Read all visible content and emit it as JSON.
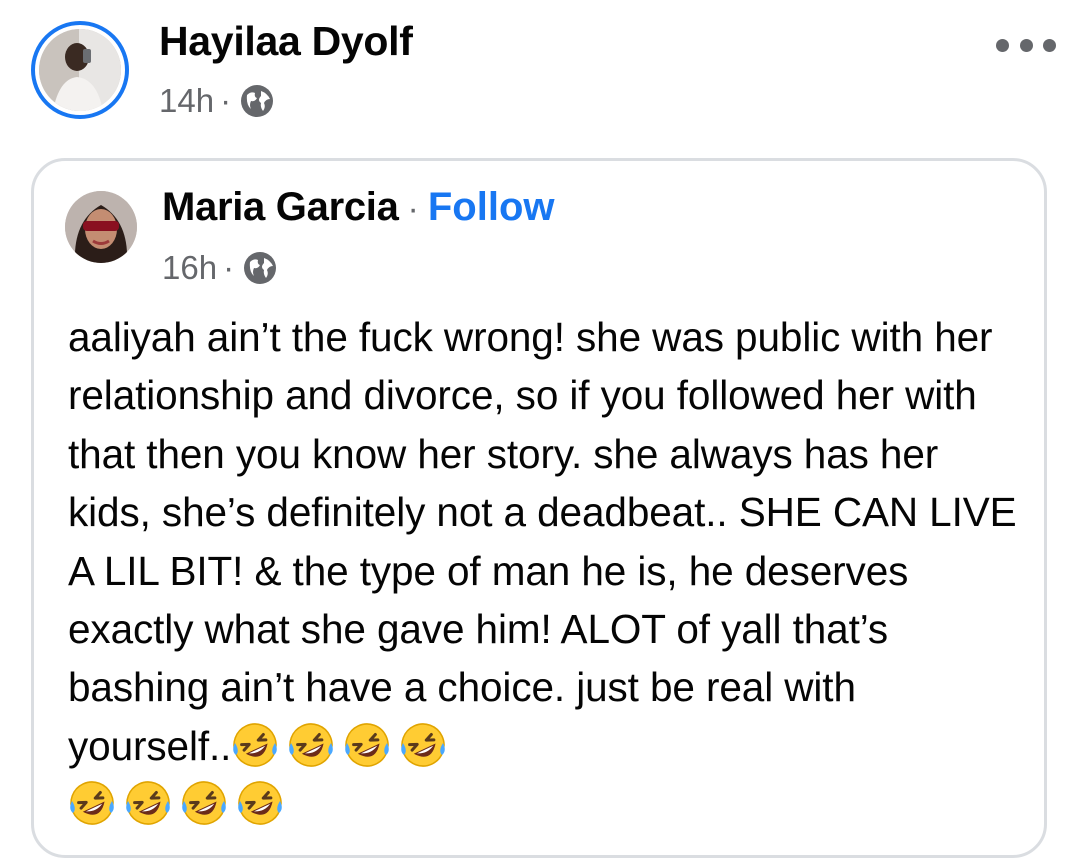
{
  "post": {
    "author": "Hayilaa Dyolf",
    "time": "14h",
    "separator": "·",
    "privacy_icon": "globe-icon",
    "more_icon": "more-horizontal-icon"
  },
  "shared": {
    "author": "Maria Garcia",
    "separator": "·",
    "follow_label": "Follow",
    "time": "16h",
    "privacy_icon": "globe-icon",
    "text": "aaliyah ain’t the fuck wrong! she was public with her relationship and divorce, so if you followed her with that then you know her story. she always has her kids, she’s definitely not a deadbeat.. SHE CAN LIVE A LIL BIT! & the type of man he is, he deserves exactly what she gave him! ALOT of yall that’s bashing ain’t have a choice. just be real with yourself..",
    "emoji": "🤣🤣🤣🤣🤣🤣🤣🤣",
    "emoji_count": 8
  },
  "colors": {
    "accent": "#1877f2",
    "secondary_text": "#65676b",
    "border": "#dadde1"
  }
}
